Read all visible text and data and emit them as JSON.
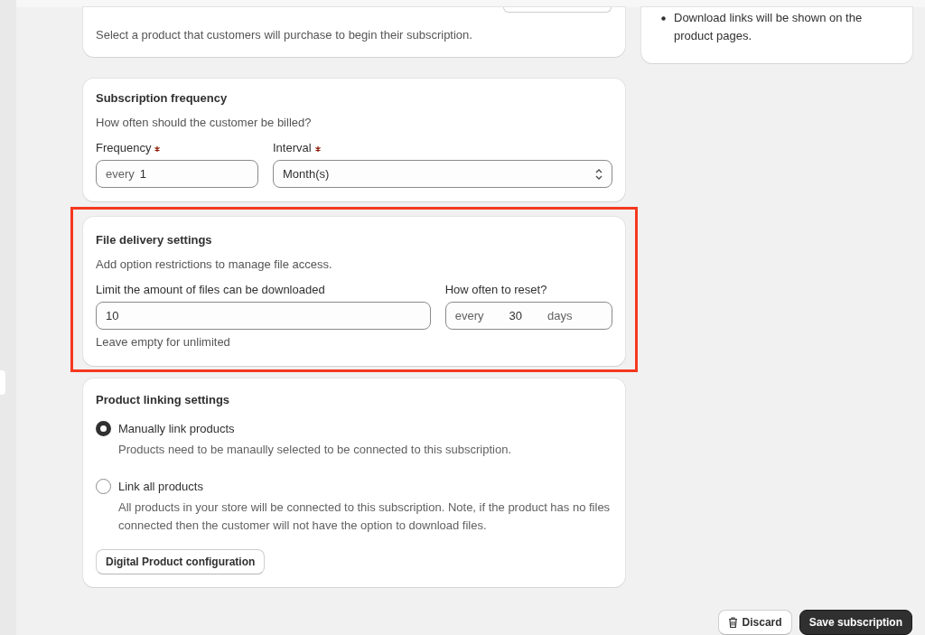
{
  "product_card": {
    "description": "Select a product that customers will purchase to begin their subscription."
  },
  "frequency_card": {
    "title": "Subscription frequency",
    "description": "How often should the customer be billed?",
    "fields": [
      {
        "kind": "text",
        "label": "Frequency",
        "required": true,
        "prefix": "every",
        "value": "1"
      },
      {
        "kind": "select",
        "label": "Interval",
        "required": true,
        "value": "Month(s)"
      }
    ]
  },
  "file_delivery_card": {
    "highlighted": true,
    "title": "File delivery settings",
    "description": "Add option restrictions to manage file access.",
    "limit_field": {
      "label": "Limit the amount of files can be downloaded",
      "value": "10",
      "help": "Leave empty for unlimited"
    },
    "reset_field": {
      "label": "How often to reset?",
      "prefix": "every",
      "value": "30",
      "suffix": "days"
    }
  },
  "product_linking_card": {
    "title": "Product linking settings",
    "options": [
      {
        "label": "Manually link products",
        "description": "Products need to be manaully selected to be connected to this subscription.",
        "selected": true
      },
      {
        "label": "Link all products",
        "description": "All products in your store will be connected to this subscription. Note, if the product has no files connected then the customer will not have the option to download files.",
        "selected": false
      }
    ],
    "button": "Digital Product configuration"
  },
  "info_card": {
    "items": [
      "Download links will be shown on the product pages."
    ]
  },
  "actions": {
    "discard": "Discard",
    "save": "Save subscription"
  }
}
